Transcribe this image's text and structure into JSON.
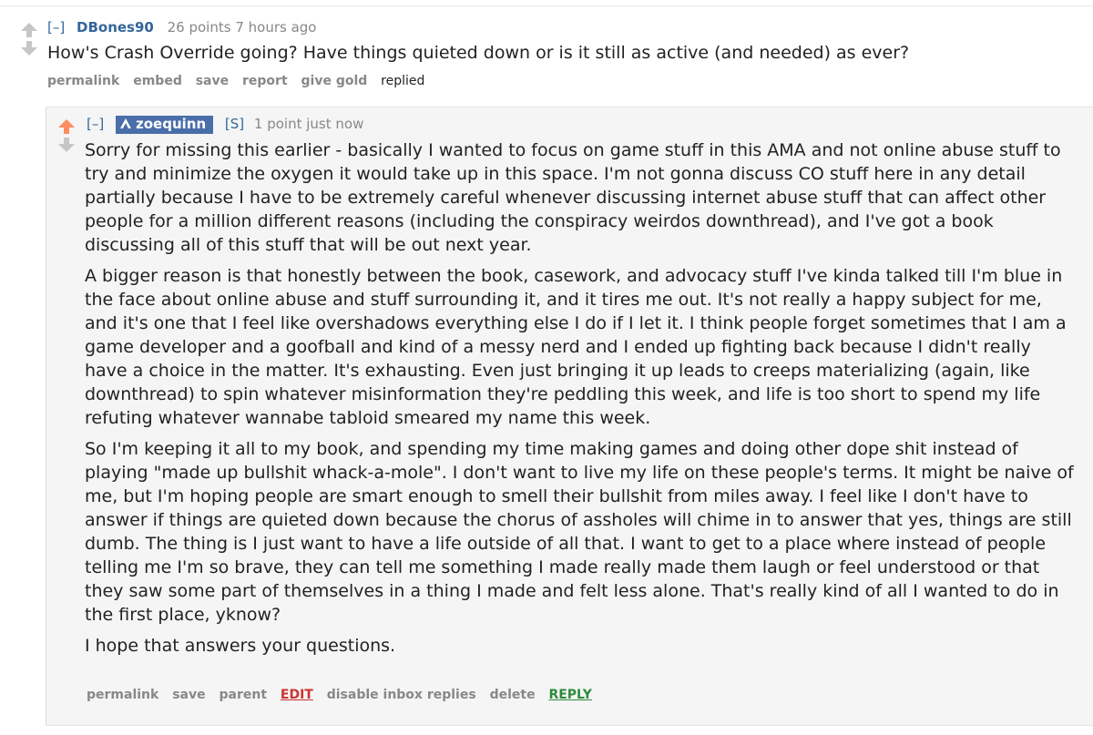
{
  "parent_comment": {
    "expand": "[–]",
    "author": "DBones90",
    "meta": "26 points 7 hours ago",
    "body": "How's Crash Override going? Have things quieted down or is it still as active (and needed) as ever?",
    "actions": {
      "permalink": "permalink",
      "embed": "embed",
      "save": "save",
      "report": "report",
      "give_gold": "give gold",
      "replied": "replied"
    }
  },
  "reply_comment": {
    "expand": "[–]",
    "author": "zoequinn",
    "submitter_flag": "[S]",
    "meta": "1 point just now",
    "paragraphs": [
      "Sorry for missing this earlier - basically I wanted to focus on game stuff in this AMA and not online abuse stuff to try and minimize the oxygen it would take up in this space. I'm not gonna discuss CO stuff here in any detail partially because I have to be extremely careful whenever discussing internet abuse stuff that can affect other people for a million different reasons (including the conspiracy weirdos downthread), and I've got a book discussing all of this stuff that will be out next year.",
      "A bigger reason is that honestly between the book, casework, and advocacy stuff I've kinda talked till I'm blue in the face about online abuse and stuff surrounding it, and it tires me out. It's not really a happy subject for me, and it's one that I feel like overshadows everything else I do if I let it. I think people forget sometimes that I am a game developer and a goofball and kind of a messy nerd and I ended up fighting back because I didn't really have a choice in the matter. It's exhausting. Even just bringing it up leads to creeps materializing (again, like downthread) to spin whatever misinformation they're peddling this week, and life is too short to spend my life refuting whatever wannabe tabloid smeared my name this week.",
      "So I'm keeping it all to my book, and spending my time making games and doing other dope shit instead of playing \"made up bullshit whack-a-mole\". I don't want to live my life on these people's terms. It might be naive of me, but I'm hoping people are smart enough to smell their bullshit from miles away. I feel like I don't have to answer if things are quieted down because the chorus of assholes will chime in to answer that yes, things are still dumb. The thing is I just want to have a life outside of all that. I want to get to a place where instead of people telling me I'm so brave, they can tell me something I made really made them laugh or feel understood or that they saw some part of themselves in a thing I made and felt less alone. That's really kind of all I wanted to do in the first place, yknow?",
      "I hope that answers your questions."
    ],
    "actions": {
      "permalink": "permalink",
      "save": "save",
      "parent": "parent",
      "edit": "EDIT",
      "disable_inbox": "disable inbox replies",
      "delete": "delete",
      "reply": "REPLY"
    }
  },
  "colors": {
    "upvoted": "#ff8b60",
    "neutral_arrow": "#c6c6c6",
    "author_link": "#336699",
    "mod_badge": "#4a6ea9",
    "edit": "#cc3333",
    "reply": "#2e8b3d"
  },
  "icons": {
    "upvote": "upvote-arrow-icon",
    "downvote": "downvote-arrow-icon",
    "mod": "mod-shield-icon"
  }
}
